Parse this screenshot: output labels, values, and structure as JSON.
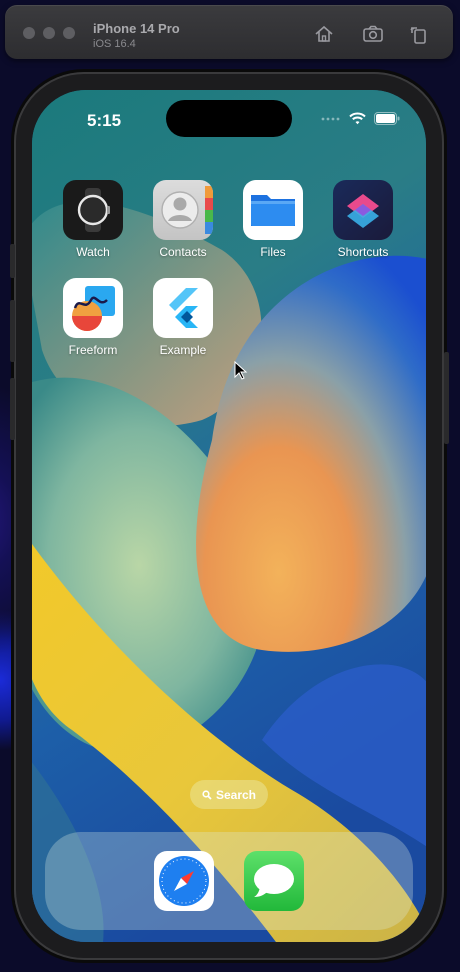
{
  "simulator": {
    "device_name": "iPhone 14 Pro",
    "os_version": "iOS 16.4",
    "toolbar_icons": [
      "home-icon",
      "screenshot-icon",
      "rotate-icon"
    ]
  },
  "status_bar": {
    "time": "5:15",
    "icons": [
      "cellular-dots-icon",
      "wifi-icon",
      "battery-icon"
    ]
  },
  "home_apps": [
    {
      "label": "Watch",
      "icon": "watch-icon"
    },
    {
      "label": "Contacts",
      "icon": "contacts-icon"
    },
    {
      "label": "Files",
      "icon": "files-icon"
    },
    {
      "label": "Shortcuts",
      "icon": "shortcuts-icon"
    },
    {
      "label": "Freeform",
      "icon": "freeform-icon"
    },
    {
      "label": "Example",
      "icon": "flutter-icon"
    }
  ],
  "search": {
    "label": "Search",
    "icon": "search-icon"
  },
  "dock_apps": [
    {
      "name": "Safari",
      "icon": "safari-icon"
    },
    {
      "name": "Messages",
      "icon": "messages-icon"
    }
  ],
  "colors": {
    "accent_blue": "#1e7ff0",
    "messages_green": "#2ec84a",
    "shortcuts_pink": "#e84a8c"
  }
}
